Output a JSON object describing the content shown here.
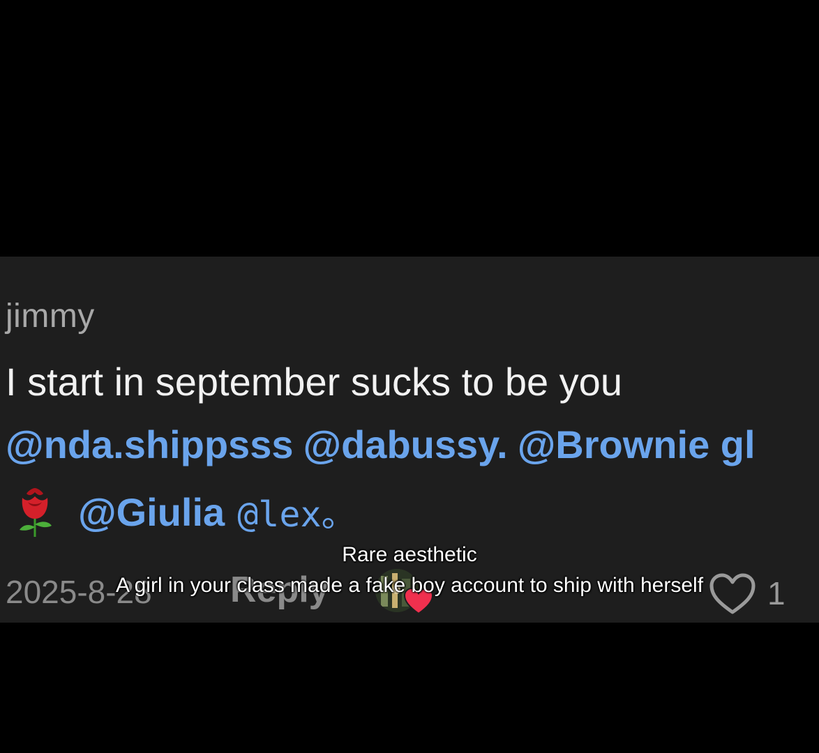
{
  "comment": {
    "username": "jimmy",
    "text": "I start in september sucks to be you",
    "mentions_line1": [
      "@nda.shippsss",
      "@dabussy.",
      "@Brownie gl"
    ],
    "mentions_line2": [
      "@Giulia",
      "@lex。"
    ],
    "emoji": "rose-icon",
    "timestamp": "2025-8-28",
    "reply_label": "Reply",
    "like_count": "1"
  },
  "caption": {
    "title": "Rare aesthetic",
    "subtitle": "A girl in your class made a fake boy account to ship with herself"
  },
  "colors": {
    "background": "#000000",
    "card": "#1e1e1e",
    "mention": "#6aa4ec",
    "username": "#a8a8a8",
    "text": "#f2f2f2",
    "heart": "#f0304e"
  }
}
